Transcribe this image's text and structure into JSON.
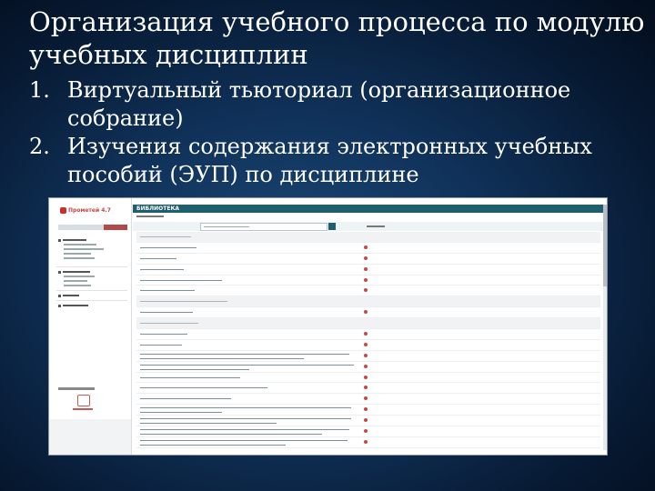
{
  "slide": {
    "title": "Организация учебного процесса по модулю учебных дисциплин",
    "items": [
      {
        "num": "1.",
        "text": "Виртуальный тьюториал (организационное собрание)"
      },
      {
        "num": "2.",
        "text": "Изучения содержания электронных учебных пособий (ЭУП) по дисциплине"
      }
    ]
  },
  "screenshot": {
    "logo_text": "Прометей 4.7",
    "header": "БИБЛИОТЕКА",
    "accent": "#1f5e6e",
    "pdf_color": "#c74848"
  }
}
